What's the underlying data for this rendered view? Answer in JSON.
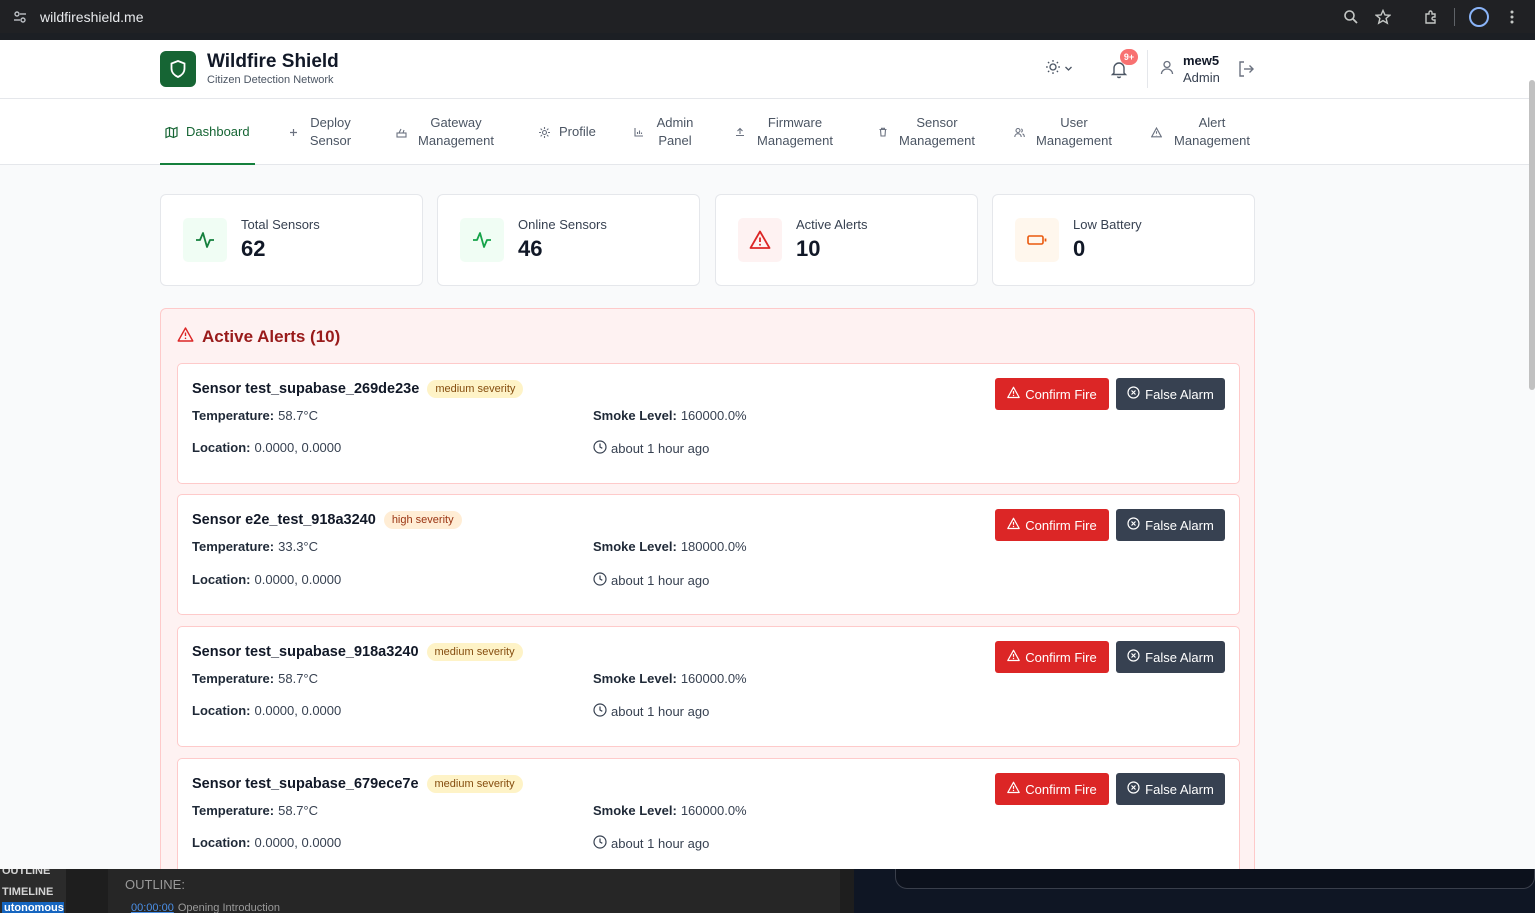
{
  "browser": {
    "url": "wildfireshield.me"
  },
  "header": {
    "brand_title": "Wildfire Shield",
    "brand_subtitle": "Citizen Detection Network",
    "notification_badge": "9+",
    "user_name": "mew5",
    "user_role": "Admin"
  },
  "nav": {
    "items": [
      {
        "label": "Dashboard",
        "icon": "map-icon",
        "active": true
      },
      {
        "label": "Deploy Sensor",
        "icon": "plus-icon"
      },
      {
        "label": "Gateway Management",
        "icon": "router-icon"
      },
      {
        "label": "Profile",
        "icon": "gear-icon"
      },
      {
        "label": "Admin Panel",
        "icon": "chart-icon"
      },
      {
        "label": "Firmware Management",
        "icon": "upload-icon"
      },
      {
        "label": "Sensor Management",
        "icon": "trash-icon"
      },
      {
        "label": "User Management",
        "icon": "users-icon"
      },
      {
        "label": "Alert Management",
        "icon": "warning-icon"
      }
    ]
  },
  "stats": [
    {
      "label": "Total Sensors",
      "value": "62",
      "icon": "activity-icon",
      "color": "#15803d",
      "bg": "#f0fdf4"
    },
    {
      "label": "Online Sensors",
      "value": "46",
      "icon": "activity-icon",
      "color": "#16a34a",
      "bg": "#f0fdf4"
    },
    {
      "label": "Active Alerts",
      "value": "10",
      "icon": "warning-icon",
      "color": "#dc2626",
      "bg": "#fef2f2"
    },
    {
      "label": "Low Battery",
      "value": "0",
      "icon": "battery-icon",
      "color": "#ea580c",
      "bg": "#fff7ed"
    }
  ],
  "alerts": {
    "title": "Active Alerts (10)",
    "labels": {
      "temperature": "Temperature:",
      "smoke": "Smoke Level:",
      "location": "Location:",
      "confirm": "Confirm Fire",
      "false_alarm": "False Alarm"
    },
    "items": [
      {
        "name": "Sensor test_supabase_269de23e",
        "severity": "medium severity",
        "level": "medium",
        "temperature": "58.7°C",
        "smoke": "160000.0%",
        "location": "0.0000, 0.0000",
        "time": "about 1 hour ago"
      },
      {
        "name": "Sensor e2e_test_918a3240",
        "severity": "high severity",
        "level": "high",
        "temperature": "33.3°C",
        "smoke": "180000.0%",
        "location": "0.0000, 0.0000",
        "time": "about 1 hour ago"
      },
      {
        "name": "Sensor test_supabase_918a3240",
        "severity": "medium severity",
        "level": "medium",
        "temperature": "58.7°C",
        "smoke": "160000.0%",
        "location": "0.0000, 0.0000",
        "time": "about 1 hour ago"
      },
      {
        "name": "Sensor test_supabase_679ece7e",
        "severity": "medium severity",
        "level": "medium",
        "temperature": "58.7°C",
        "smoke": "160000.0%",
        "location": "0.0000, 0.0000",
        "time": "about 1 hour ago"
      }
    ]
  },
  "desktop": {
    "left_labels": [
      "OUTLINE",
      "TIMELINE",
      "utonomous"
    ],
    "outline_title": "OUTLINE:",
    "outline_timecode": "00:00:00",
    "outline_entry": "Opening Introduction"
  }
}
